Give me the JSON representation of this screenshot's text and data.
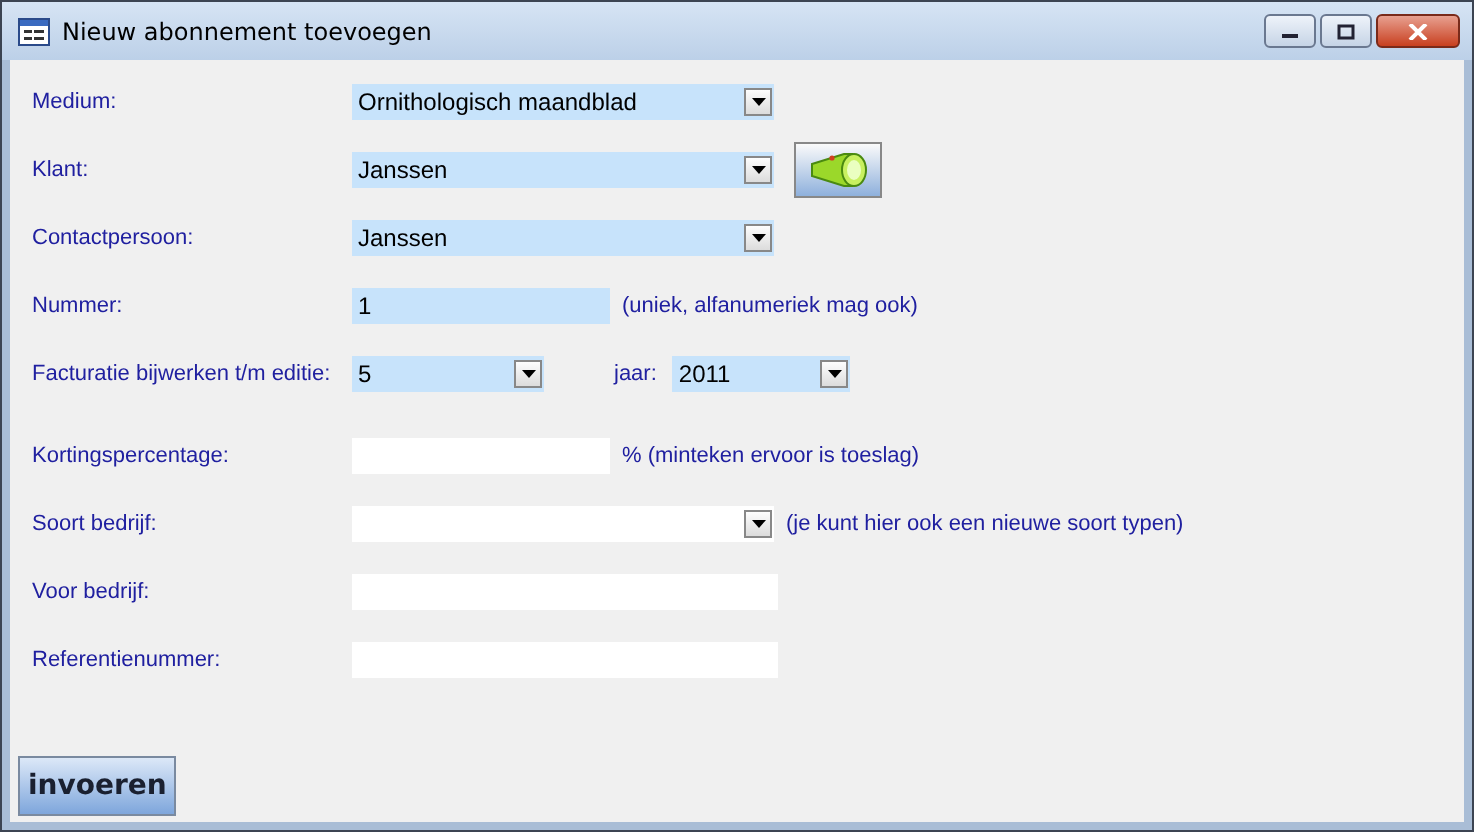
{
  "window": {
    "title": "Nieuw abonnement toevoegen"
  },
  "fields": [
    {
      "label": "Medium:",
      "kind": "combo",
      "value": "Ornithologisch maandblad",
      "highlighted": true
    },
    {
      "label": "Klant:",
      "kind": "combo",
      "value": "Janssen",
      "highlighted": true,
      "has_search_button": true
    },
    {
      "label": "Contactpersoon:",
      "kind": "combo",
      "value": "Janssen",
      "highlighted": true
    },
    {
      "label": "Nummer:",
      "kind": "text",
      "value": "1",
      "highlighted": true,
      "note": "(uniek, alfanumeriek mag ook)"
    },
    {
      "label": "Facturatie bijwerken t/m editie:",
      "kind": "combo",
      "value": "5",
      "highlighted": true,
      "second": {
        "label": "jaar:",
        "kind": "combo",
        "value": "2011",
        "highlighted": true
      }
    },
    {
      "label": "Kortingspercentage:",
      "kind": "text",
      "highlighted": false,
      "note": "% (minteken ervoor is toeslag)"
    },
    {
      "label": "Soort bedrijf:",
      "kind": "combo",
      "highlighted": false,
      "note": "(je kunt hier ook een nieuwe soort typen)"
    },
    {
      "label": "Voor bedrijf:",
      "kind": "text",
      "highlighted": false
    },
    {
      "label": "Referentienummer:",
      "kind": "text",
      "highlighted": false
    }
  ],
  "submit_button": "invoeren"
}
